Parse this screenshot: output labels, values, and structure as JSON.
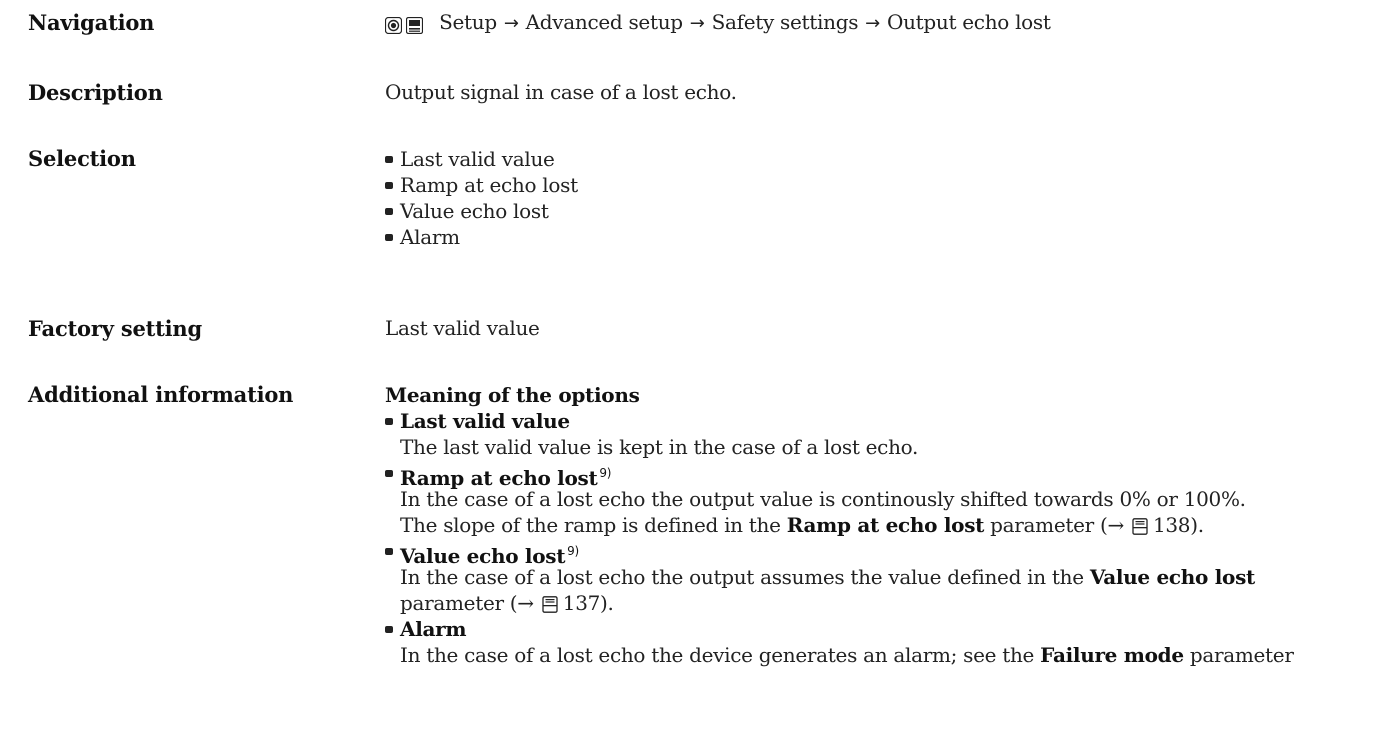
{
  "navigation": {
    "label": "Navigation",
    "path": [
      "Setup",
      "Advanced setup",
      "Safety settings",
      "Output echo lost"
    ],
    "icons": [
      "expert-operation-icon",
      "display-icon"
    ],
    "arrow": "→"
  },
  "description": {
    "label": "Description",
    "text": "Output signal in case of a lost echo."
  },
  "selection": {
    "label": "Selection",
    "items": [
      "Last valid value",
      "Ramp at echo lost",
      "Value echo lost",
      "Alarm"
    ]
  },
  "factory_setting": {
    "label": "Factory setting",
    "value": "Last valid value"
  },
  "additional_information": {
    "label": "Additional information",
    "heading": "Meaning of the options",
    "options": [
      {
        "title": "Last valid value",
        "footnote": "",
        "text": "The last valid value is kept in the case of a lost echo."
      },
      {
        "title": "Ramp at echo lost",
        "footnote": "9)",
        "text_line1": "In the case of a lost echo the output value is continously shifted towards 0% or 100%.",
        "text_line2_prefix": "The slope of the ramp is defined in the",
        "text_line2_bold": "Ramp at echo lost",
        "text_line2_suffix": "parameter (→",
        "page_ref": "138",
        "text_line2_end": ")."
      },
      {
        "title": "Value echo lost",
        "footnote": "9)",
        "text_line1_prefix": "In the case of a lost echo the output assumes the value defined in the",
        "text_line1_bold": "Value echo lost",
        "text_line2_prefix": "parameter (→",
        "page_ref": "137",
        "text_line2_end": ")."
      },
      {
        "title": "Alarm",
        "footnote": "",
        "text_prefix": "In the case of a lost echo the device generates an alarm; see the",
        "text_bold": "Failure mode",
        "text_suffix": "parameter"
      }
    ]
  }
}
